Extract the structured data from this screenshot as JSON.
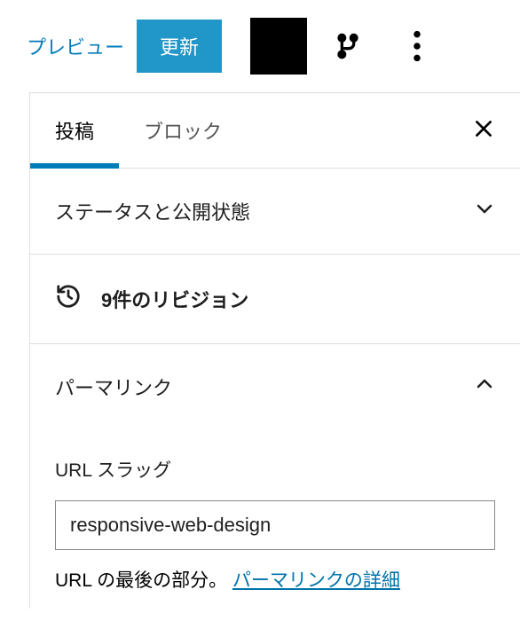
{
  "toolbar": {
    "preview_label": "プレビュー",
    "update_label": "更新"
  },
  "tabs": {
    "post_label": "投稿",
    "block_label": "ブロック"
  },
  "sections": {
    "status": {
      "title": "ステータスと公開状態"
    },
    "revisions": {
      "text": "9件のリビジョン"
    },
    "permalink": {
      "title": "パーマリンク",
      "slug_label": "URL スラッグ",
      "slug_value": "responsive-web-design",
      "helper_text": "URL の最後の部分。 ",
      "helper_link": "パーマリンクの詳細"
    }
  }
}
